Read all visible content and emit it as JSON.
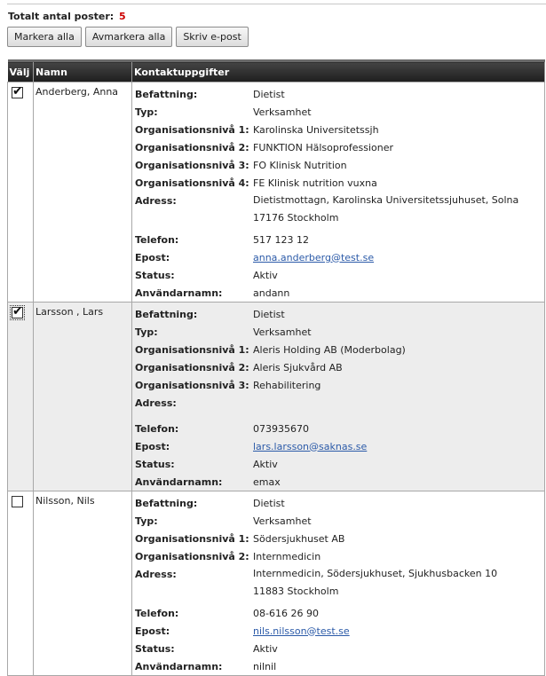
{
  "summary": {
    "label": "Totalt antal poster:",
    "count": "5"
  },
  "buttons": {
    "select_all": "Markera alla",
    "deselect_all": "Avmarkera alla",
    "write_email": "Skriv e-post"
  },
  "columns": {
    "select": "Välj",
    "name": "Namn",
    "contact": "Kontaktuppgifter"
  },
  "labels": {
    "title": "Befattning:",
    "type": "Typ:",
    "org1": "Organisationsnivå 1:",
    "org2": "Organisationsnivå 2:",
    "org3": "Organisationsnivå 3:",
    "org4": "Organisationsnivå 4:",
    "address": "Adress:",
    "phone": "Telefon:",
    "email": "Epost:",
    "status": "Status:",
    "username": "Användarnamn:"
  },
  "records": [
    {
      "checked": true,
      "name": "Anderberg, Anna",
      "title": "Dietist",
      "type": "Verksamhet",
      "org1": "Karolinska Universitetssjh",
      "org2": "FUNKTION Hälsoprofessioner",
      "org3": "FO Klinisk Nutrition",
      "org4": "FE Klinisk nutrition vuxna",
      "address_line1": "Dietistmottagn, Karolinska Universitetssjuhuset, Solna",
      "address_line2": "17176 Stockholm",
      "phone": "517 123 12",
      "email": "anna.anderberg@test.se",
      "status": "Aktiv",
      "username": "andann"
    },
    {
      "checked": true,
      "name": "Larsson , Lars",
      "title": "Dietist",
      "type": "Verksamhet",
      "org1": "Aleris Holding AB (Moderbolag)",
      "org2": "Aleris Sjukvård AB",
      "org3": "Rehabilitering",
      "phone": "073935670",
      "email": "lars.larsson@saknas.se",
      "status": "Aktiv",
      "username": "emax"
    },
    {
      "checked": false,
      "name": "Nilsson, Nils",
      "title": "Dietist",
      "type": "Verksamhet",
      "org1": "Södersjukhuset AB",
      "org2": "Internmedicin",
      "address_line1": "Internmedicin, Södersjukhuset, Sjukhusbacken 10",
      "address_line2": "11883 Stockholm",
      "phone": "08-616 26 90",
      "email": "nils.nilsson@test.se",
      "status": "Aktiv",
      "username": "nilnil"
    }
  ]
}
